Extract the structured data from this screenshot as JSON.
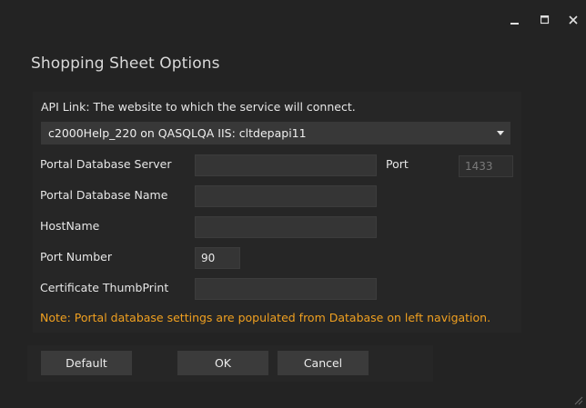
{
  "window": {
    "title": "Shopping Sheet Options",
    "controls": [
      "minimize-icon",
      "maximize-icon",
      "close-icon"
    ]
  },
  "api_link": {
    "label": "API Link: The website to which the service will connect.",
    "selected": "c2000Help_220 on QASQLQA IIS: cltdepapi11"
  },
  "fields": {
    "portal_db_server": {
      "label": "Portal Database Server",
      "value": ""
    },
    "port": {
      "label": "Port",
      "value": "1433"
    },
    "portal_db_name": {
      "label": "Portal Database Name",
      "value": ""
    },
    "hostname": {
      "label": "HostName",
      "value": ""
    },
    "port_number": {
      "label": "Port Number",
      "value": "90"
    },
    "cert_thumbprint": {
      "label": "Certificate ThumbPrint",
      "value": ""
    }
  },
  "note": "Note: Portal database settings are populated from Database on left navigation.",
  "buttons": {
    "default": "Default",
    "ok": "OK",
    "cancel": "Cancel"
  },
  "colors": {
    "background": "#232323",
    "panel": "#262626",
    "input": "#353535",
    "button": "#3b3b3b",
    "note": "#f0a020"
  }
}
